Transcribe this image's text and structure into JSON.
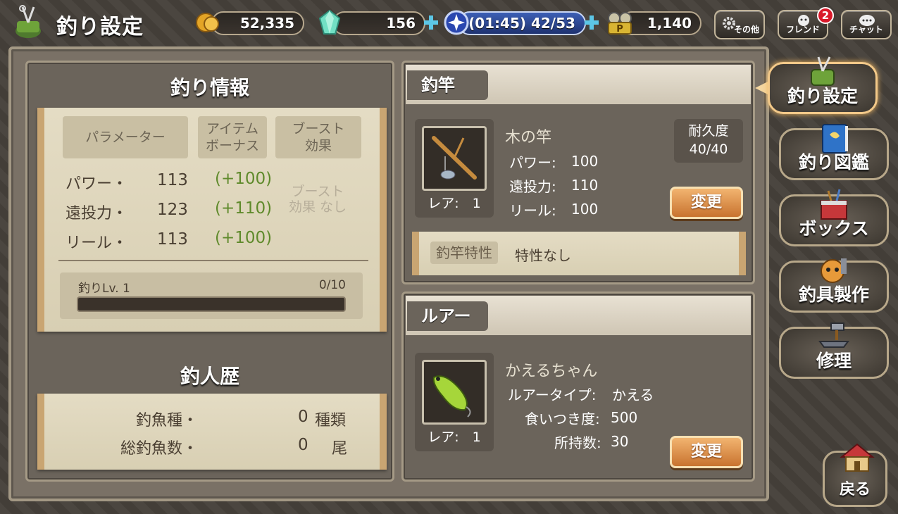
{
  "header": {
    "title": "釣り設定",
    "gold": "52,335",
    "gems": "156",
    "stamina": "(01:45) 42/53",
    "points": "1,140",
    "points_icon_letter": "P",
    "settings_label": "その他",
    "friend_label": "フレンド",
    "friend_badge": "2",
    "chat_label": "チャット"
  },
  "fishing_info": {
    "title": "釣り情報",
    "headers": {
      "param": "パラメーター",
      "item_bonus": "アイテム ボーナス",
      "boost": "ブースト 効果"
    },
    "rows": [
      {
        "label": "パワー・",
        "value": "113",
        "bonus": "(+100)"
      },
      {
        "label": "遠投力・",
        "value": "123",
        "bonus": "(+110)"
      },
      {
        "label": "リール・",
        "value": "113",
        "bonus": "(+100)"
      }
    ],
    "boost_none": "ブースト 効果 なし",
    "level_label": "釣りLv. 1",
    "level_progress": "0/10",
    "level_fraction": 0
  },
  "history": {
    "title": "釣人歴",
    "rows": [
      {
        "label": "釣魚種・",
        "value": "0",
        "unit": "種類"
      },
      {
        "label": "総釣魚数・",
        "value": "0",
        "unit": "尾"
      }
    ]
  },
  "rod": {
    "tab": "釣竿",
    "name": "木の竿",
    "rare": "レア:　1",
    "stats": [
      {
        "label": "パワー:",
        "value": "100"
      },
      {
        "label": "遠投力:",
        "value": "110"
      },
      {
        "label": "リール:",
        "value": "100"
      }
    ],
    "durability_label": "耐久度",
    "durability_value": "40/40",
    "change_label": "変更",
    "trait_tag": "釣竿特性",
    "trait_text": "特性なし"
  },
  "lure": {
    "tab": "ルアー",
    "name": "かえるちゃん",
    "rare": "レア:　1",
    "stats": [
      {
        "label": "ルアータイプ:",
        "value": "かえる"
      },
      {
        "label": "食いつき度:",
        "value": "500"
      },
      {
        "label": "所持数:",
        "value": "30"
      }
    ],
    "change_label": "変更"
  },
  "side_menu": {
    "items": [
      {
        "label": "釣り設定"
      },
      {
        "label": "釣り図鑑"
      },
      {
        "label": "ボックス"
      },
      {
        "label": "釣具製作"
      },
      {
        "label": "修理"
      }
    ],
    "back": "戻る"
  },
  "colors": {
    "bonus_green": "#5f8a2b",
    "change_button": "#d8843c",
    "badge_red": "#d9192a"
  }
}
